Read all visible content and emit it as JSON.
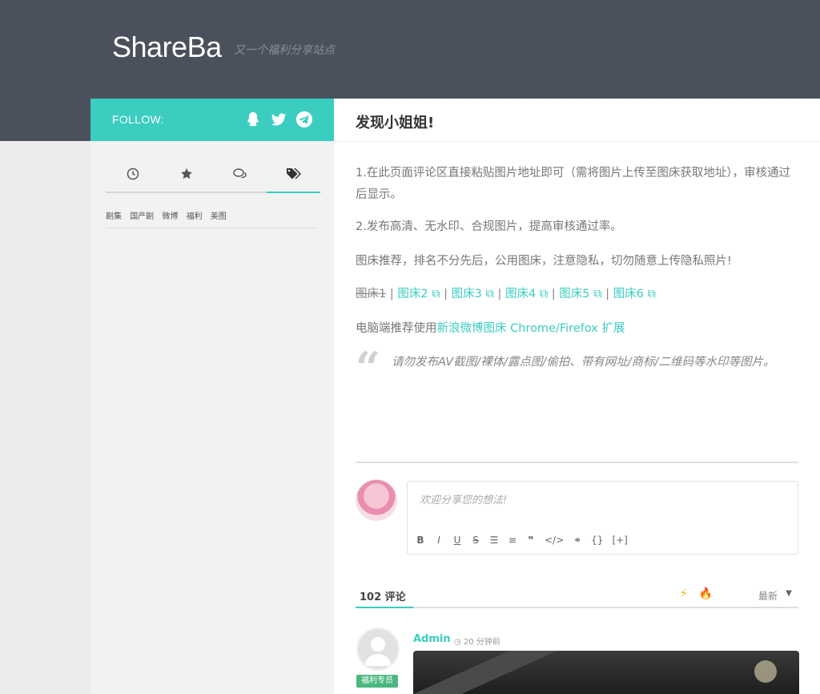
{
  "header": {
    "brand": "ShareBa",
    "tagline": "又一个福利分享站点"
  },
  "sidebar": {
    "follow_label": "FOLLOW:",
    "follow_icons": [
      "qq-icon",
      "twitter-icon",
      "telegram-icon"
    ],
    "tab_icons": [
      "clock-icon",
      "star-icon",
      "comments-icon",
      "tags-icon"
    ],
    "active_tab": 3,
    "tags": [
      "剧集",
      "国产剧",
      "微博",
      "福利",
      "美图"
    ]
  },
  "main": {
    "title": "发现小姐姐!",
    "p1": "1.在此页面评论区直接粘贴图片地址即可（需将图片上传至图床获取地址），审核通过后显示。",
    "p2": "2.发布高清、无水印、合规图片，提高审核通过率。",
    "p3": "图床推荐，排名不分先后，公用图床，注意隐私，切勿随意上传隐私照片!",
    "hosts": {
      "host1": "图床1",
      "host2": "图床2",
      "host3": "图床3",
      "host4": "图床4",
      "host5": "图床5",
      "host6": "图床6"
    },
    "p5_prefix": "电脑端推荐使用",
    "p5_link": "新浪微博图床 Chrome/Firefox 扩展",
    "quote": "请勿发布AV截图/裸体/露点图/偷拍、带有网址/商标/二维码等水印等图片。"
  },
  "comment_box": {
    "placeholder": "欢迎分享您的想法!",
    "toolbar": [
      "B",
      "I",
      "U",
      "S",
      "ol",
      "ul",
      "quote",
      "code",
      "link",
      "{}",
      "[+]"
    ]
  },
  "comments": {
    "count_label": "102 评论",
    "sort_label": "最新",
    "first": {
      "author": "Admin",
      "time": "20 分钟前",
      "badge": "福利专员"
    }
  },
  "colors": {
    "accent": "#3bcdc0",
    "header_bg": "#4a505c",
    "sidebar_bg": "#f2f2f2"
  }
}
